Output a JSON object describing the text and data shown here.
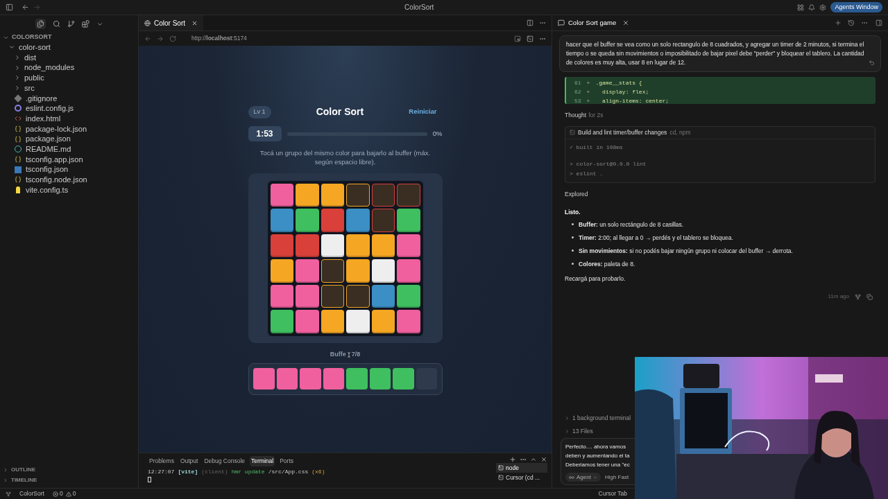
{
  "title_bar": {
    "title": "ColorSort",
    "agents_button": "Agents Window"
  },
  "explorer": {
    "root": "COLORSORT",
    "tree": [
      {
        "label": "color-sort",
        "kind": "folder",
        "expanded": true,
        "children": [
          {
            "label": "dist",
            "kind": "folder",
            "expanded": false
          },
          {
            "label": "node_modules",
            "kind": "folder",
            "expanded": false
          },
          {
            "label": "public",
            "kind": "folder",
            "expanded": false
          },
          {
            "label": "src",
            "kind": "folder",
            "expanded": false
          },
          {
            "label": ".gitignore",
            "kind": "git"
          },
          {
            "label": "eslint.config.js",
            "kind": "eslint"
          },
          {
            "label": "index.html",
            "kind": "html"
          },
          {
            "label": "package-lock.json",
            "kind": "json"
          },
          {
            "label": "package.json",
            "kind": "json"
          },
          {
            "label": "README.md",
            "kind": "info"
          },
          {
            "label": "tsconfig.app.json",
            "kind": "json"
          },
          {
            "label": "tsconfig.json",
            "kind": "ts"
          },
          {
            "label": "tsconfig.node.json",
            "kind": "json"
          },
          {
            "label": "vite.config.ts",
            "kind": "vite"
          }
        ]
      }
    ],
    "sections": [
      {
        "label": "OUTLINE",
        "expanded": false
      },
      {
        "label": "TIMELINE",
        "expanded": false
      }
    ]
  },
  "editor_tab": {
    "label": "Color Sort"
  },
  "browser": {
    "url": "http://**localhost**:5174"
  },
  "game": {
    "level": "Lv 1",
    "title": "Color Sort",
    "restart": "Reiniciar",
    "timer": "1:53",
    "progress": {
      "reading": "0%"
    },
    "instructions": "Tocá un grupo del mismo color para bajarlo al buffer (máx. según espacio libre).",
    "board": [
      [
        {
          "color": "#f0609e",
          "dimmed": false
        },
        {
          "color": "#f5a623",
          "dimmed": false
        },
        {
          "color": "#f5a623",
          "dimmed": false
        },
        {
          "color": "#f5a623",
          "dimmed": true
        },
        {
          "color": "#d9403a",
          "dimmed": true
        },
        {
          "color": "#d9403a",
          "dimmed": true
        }
      ],
      [
        {
          "color": "#3b8fc4",
          "dimmed": false
        },
        {
          "color": "#3fbf5f",
          "dimmed": false
        },
        {
          "color": "#d9403a",
          "dimmed": false
        },
        {
          "color": "#3b8fc4",
          "dimmed": false
        },
        {
          "color": "#d9403a",
          "dimmed": true
        },
        {
          "color": "#3fbf5f",
          "dimmed": false
        }
      ],
      [
        {
          "color": "#d9403a",
          "dimmed": false
        },
        {
          "color": "#d9403a",
          "dimmed": false
        },
        {
          "color": "#eeeeee",
          "dimmed": false
        },
        {
          "color": "#f5a623",
          "dimmed": false
        },
        {
          "color": "#f5a623",
          "dimmed": false
        },
        {
          "color": "#f0609e",
          "dimmed": false
        }
      ],
      [
        {
          "color": "#f5a623",
          "dimmed": false
        },
        {
          "color": "#f0609e",
          "dimmed": false
        },
        {
          "color": "#f5a623",
          "dimmed": true
        },
        {
          "color": "#f5a623",
          "dimmed": false
        },
        {
          "color": "#eeeeee",
          "dimmed": false
        },
        {
          "color": "#f0609e",
          "dimmed": false
        }
      ],
      [
        {
          "color": "#f0609e",
          "dimmed": false
        },
        {
          "color": "#f0609e",
          "dimmed": false
        },
        {
          "color": "#f5a623",
          "dimmed": true
        },
        {
          "color": "#f5a623",
          "dimmed": true
        },
        {
          "color": "#3b8fc4",
          "dimmed": false
        },
        {
          "color": "#3fbf5f",
          "dimmed": false
        }
      ],
      [
        {
          "color": "#3fbf5f",
          "dimmed": false
        },
        {
          "color": "#f0609e",
          "dimmed": false
        },
        {
          "color": "#f5a623",
          "dimmed": false
        },
        {
          "color": "#eeeeee",
          "dimmed": false
        },
        {
          "color": "#f5a623",
          "dimmed": false
        },
        {
          "color": "#f0609e",
          "dimmed": false
        }
      ]
    ],
    "buffer_label": "Buffe",
    "buffer_count": "7/8",
    "buffer": [
      {
        "empty": false,
        "color": "#f0609e"
      },
      {
        "empty": false,
        "color": "#f0609e"
      },
      {
        "empty": false,
        "color": "#f0609e"
      },
      {
        "empty": false,
        "color": "#f0609e"
      },
      {
        "empty": false,
        "color": "#3fbf5f"
      },
      {
        "empty": false,
        "color": "#3fbf5f"
      },
      {
        "empty": false,
        "color": "#3fbf5f"
      },
      {
        "empty": true
      }
    ]
  },
  "terminal": {
    "tabs": [
      {
        "label": "Problems",
        "selected": false
      },
      {
        "label": "Output",
        "selected": false
      },
      {
        "label": "Debug Console",
        "selected": false
      },
      {
        "label": "Terminal",
        "selected": true
      },
      {
        "label": "Ports",
        "selected": false
      }
    ],
    "line": [
      {
        "kind": "plain",
        "text": "12:27:07"
      },
      {
        "kind": "tag",
        "text": "[vite]"
      },
      {
        "kind": "dim",
        "text": "(client)"
      },
      {
        "kind": "green",
        "text": "hmr update"
      },
      {
        "kind": "plain",
        "text": "/src/App.css"
      },
      {
        "kind": "orange",
        "text": "(x6)"
      }
    ],
    "sessions": [
      {
        "label": "node",
        "selected": true
      },
      {
        "label": "Cursor (cd ...",
        "selected": false
      }
    ]
  },
  "chat": {
    "tab": "Color Sort game",
    "prompt": "hacer que el buffer se vea como un solo rectangulo de 8 cuadrados, y agregar un timer de 2 minutos, si termina el tiempo o se queda sin movimientos o imposibilitado de bajar pixel debe \"perder\" y bloquear el tablero. La cantidad de colores es muy alta, usar 8 en lugar de 12.",
    "diff": [
      {
        "number": "61",
        "sign": "+",
        "code": ".game__stats {"
      },
      {
        "number": "62",
        "sign": "+",
        "code": "  display: flex;"
      },
      {
        "number": "53",
        "sign": "+",
        "code": "  align-items: center;"
      }
    ],
    "thought": {
      "label": "Thought",
      "detail": "for 2s"
    },
    "tool": {
      "label": "Build and lint timer/buffer changes",
      "detail": "cd, npm",
      "output": [
        "✓ built in 108ms",
        "> color-sort@0.0.0 lint",
        "> eslint ."
      ]
    },
    "explored": "Explored",
    "intro": "Listo.",
    "bullets": [
      "**Buffer:** un solo rectángulo de 8 casillas.",
      "**Timer:** 2:00; al llegar a 0 → perdés y el tablero se bloquea.",
      "**Sin movimientos:** si no podés bajar ningún grupo ni colocar del buffer → derrota.",
      "**Colores:** paleta de 8."
    ],
    "outro": "Recargá para probarlo.",
    "time": "11m ago",
    "collapsed": [
      "1 background terminal",
      "13 Files"
    ],
    "input_lines": [
      "Perfecto.... ahora vamos",
      "deben y aumentando el ta",
      "Deberiamos tener una \"ec"
    ],
    "mode": "Agent",
    "model": "High Fast"
  },
  "status_bar": {
    "project": "ColorSort",
    "errors": "0",
    "warnings": "0",
    "right": "Cursor Tab"
  }
}
